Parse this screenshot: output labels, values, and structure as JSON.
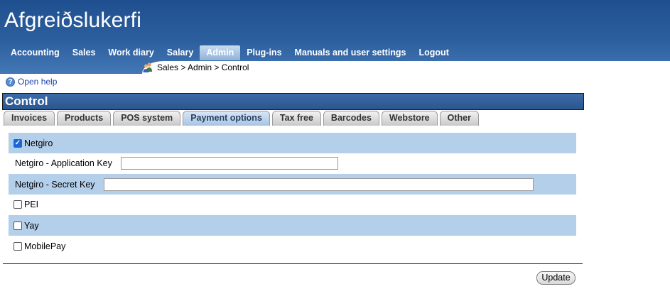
{
  "app": {
    "title": "Afgreiðslukerfi"
  },
  "nav": {
    "items": [
      {
        "label": "Accounting",
        "active": false
      },
      {
        "label": "Sales",
        "active": false
      },
      {
        "label": "Work diary",
        "active": false
      },
      {
        "label": "Salary",
        "active": false
      },
      {
        "label": "Admin",
        "active": true
      },
      {
        "label": "Plug-ins",
        "active": false
      },
      {
        "label": "Manuals and user settings",
        "active": false
      },
      {
        "label": "Logout",
        "active": false
      }
    ]
  },
  "breadcrumb": {
    "text": "Sales > Admin > Control",
    "icon": "users-icon"
  },
  "help": {
    "label": "Open help",
    "icon": "help-icon"
  },
  "panel": {
    "title": "Control"
  },
  "tabs": [
    {
      "label": "Invoices",
      "active": false
    },
    {
      "label": "Products",
      "active": false
    },
    {
      "label": "POS system",
      "active": false
    },
    {
      "label": "Payment options",
      "active": true
    },
    {
      "label": "Tax free",
      "active": false
    },
    {
      "label": "Barcodes",
      "active": false
    },
    {
      "label": "Webstore",
      "active": false
    },
    {
      "label": "Other",
      "active": false
    }
  ],
  "payment": {
    "netgiro": {
      "label": "Netgiro",
      "checked": true
    },
    "netgiro_app_key": {
      "label": "Netgiro - Application Key",
      "value": ""
    },
    "netgiro_secret_key": {
      "label": "Netgiro - Secret Key",
      "value": ""
    },
    "pei": {
      "label": "PEI",
      "checked": false
    },
    "yay": {
      "label": "Yay",
      "checked": false
    },
    "mobilepay": {
      "label": "MobilePay",
      "checked": false
    }
  },
  "actions": {
    "update_label": "Update"
  },
  "colors": {
    "header": "#2c5f9e",
    "row_shade": "#b4cfea",
    "accent": "#1a66d6"
  }
}
